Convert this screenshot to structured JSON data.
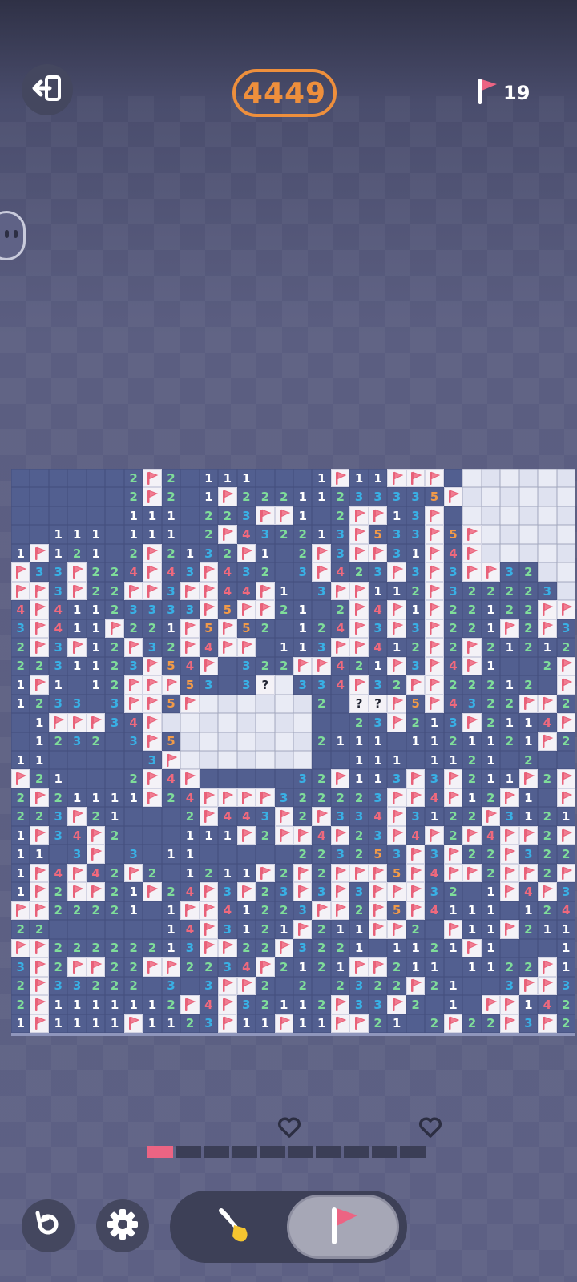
{
  "header": {
    "score": "4449",
    "flags_count": "19"
  },
  "icons": {
    "exit": "exit-icon",
    "flag": "flag-icon",
    "undo": "undo-icon",
    "settings": "gear-icon",
    "dig": "shovel-icon",
    "flag_mode": "flag-icon",
    "heart": "heart-icon"
  },
  "colors": {
    "score": "#ee8f3c",
    "flag": "#ec6483",
    "unrevealed": "#525f90",
    "num1": "#ffffff",
    "num2": "#7fdd9a",
    "num3": "#39b0e5",
    "num4": "#f0697d",
    "num5": "#f19a48"
  },
  "progress": {
    "segments_total": 10,
    "segments_filled": 1,
    "hearts": 2
  },
  "mode": {
    "selected": "flag"
  },
  "board": {
    "cols": 30,
    "rows": 30,
    "legend": "0 = unrevealed tile, . = empty revealed, 1-5 = number, F = flag, ? = question mark",
    "grid": [
      "......2F2.111...1F11FFF.......",
      "......2F2.1F22211233335F......",
      "......111.223FF1.2FF13F.......",
      "..111.111.2F432213F533F5F.....",
      "1F121.2F2132F1.2F3FF31F4F.....",
      "F33F224F43F432.3F423F3F3FF32..",
      "FF3F22FF3FF44F1.3FF112F322223.",
      "4F41123333F5FF21.2F4F1F22122FF",
      "3F411F221F5F52.124F3F3F221F2F3",
      "2F3F12F32F4FF.113FF412F2F21212",
      "2231123F54F.322FF421F3F4F1..2F",
      "1F1.12FFF53.3?.334F32FF22212.F",
      "1233.3FF5F......2.??F5F4322FF2",
      ".1FFF34F..........23F213F2114F",
      ".1232.3F5.......2111.1121121F2",
      "11.....3F.........111.1121.2..",
      "F21...2F4F.....32F113F3F211F2F",
      "2F21111F24FFFF322223FF4F12F1.F",
      "223F21...2F443F2F334F3122F3121",
      "1F34F2...111F2FF4F23F4F2F4FF2F",
      "11.3F.3.11.....223253F3F22F322",
      "1F4F42F2.1211F2F2FFF5F4FF2FF2F",
      "1F2FF21F24F3F23F3F3FFF32.1F4F3",
      "FF22221.1FF41223FF2F5F4111.124",
      "22......14F3121F211FF2.F11F211",
      "FF22222213FF22F3221.1121F1...1",
      "3F2FF22FF2234F2121FF211.1122F1",
      "2F33222.3.3FF2.2.2322F21..3FF3",
      "2F1111112F4F32112F33F2.1.FF142",
      "1F1111F1123F11F11FF21.2F22F3F2"
    ]
  }
}
